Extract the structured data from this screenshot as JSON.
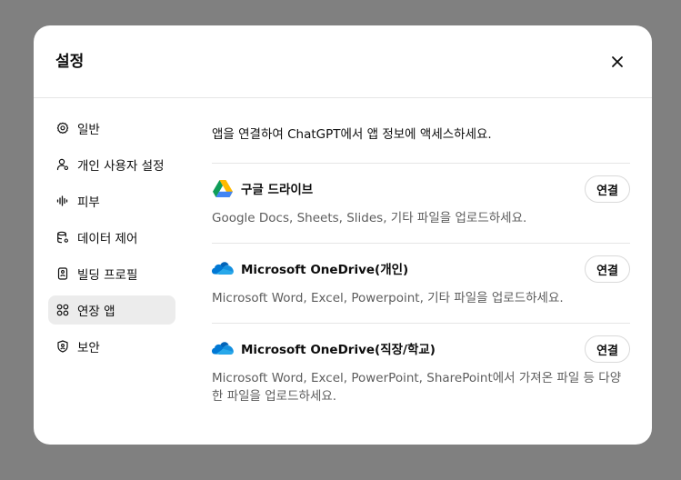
{
  "modal": {
    "title": "설정",
    "close_icon": "close-icon"
  },
  "sidebar": {
    "items": [
      {
        "label": "일반",
        "icon": "gear-icon",
        "active": false
      },
      {
        "label": "개인 사용자 설정",
        "icon": "user-settings-icon",
        "active": false
      },
      {
        "label": "피부",
        "icon": "waveform-icon",
        "active": false
      },
      {
        "label": "데이터 제어",
        "icon": "database-icon",
        "active": false
      },
      {
        "label": "빌딩 프로필",
        "icon": "id-card-icon",
        "active": false
      },
      {
        "label": "연장 앱",
        "icon": "apps-grid-icon",
        "active": true
      },
      {
        "label": "보안",
        "icon": "shield-icon",
        "active": false
      }
    ]
  },
  "content": {
    "intro": "앱을 연결하여 ChatGPT에서 앱 정보에 액세스하세요.",
    "apps": [
      {
        "name": "구글 드라이브",
        "icon": "google-drive-icon",
        "button": "연결",
        "description": "Google Docs, Sheets, Slides, 기타 파일을 업로드하세요."
      },
      {
        "name": "Microsoft OneDrive(개인)",
        "icon": "onedrive-icon",
        "button": "연결",
        "description": "Microsoft Word, Excel, Powerpoint, 기타 파일을 업로드하세요."
      },
      {
        "name": "Microsoft OneDrive(직장/학교)",
        "icon": "onedrive-icon",
        "button": "연결",
        "description": "Microsoft Word, Excel, PowerPoint, SharePoint에서 가져온 파일 등 다양한 파일을 업로드하세요."
      }
    ]
  },
  "colors": {
    "backdrop": "#808080",
    "modal_bg": "#ffffff",
    "active_item_bg": "#ececec",
    "text_primary": "#0d0d0d",
    "text_secondary": "#5d5d5d",
    "divider": "#e5e5e5"
  }
}
